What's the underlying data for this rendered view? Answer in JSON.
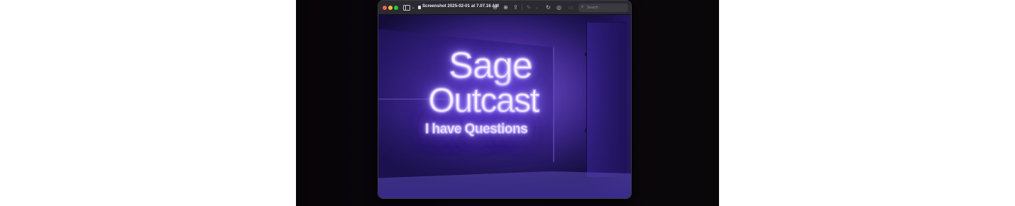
{
  "window": {
    "title": "Screenshot 2025-02-01 at 7.07.16 AM",
    "search_placeholder": "Search"
  },
  "icons": {
    "close": "close-button",
    "minimize": "minimize-button",
    "zoom": "zoom-button",
    "sidebar": "sidebar-icon",
    "document": "document-icon",
    "zoom_out": "zoom-out-icon",
    "zoom_in": "zoom-in-icon",
    "share": "share-icon",
    "markup": "markup-icon",
    "rotate": "rotate-icon",
    "annotate": "annotate-icon",
    "form": "form-fill-icon",
    "search": "search-icon"
  },
  "image": {
    "line1": "Sage",
    "line2": "Outcast",
    "line3": "I have Questions"
  },
  "colors": {
    "close": "#ff5f57",
    "minimize": "#febc2e",
    "zoom": "#28c840",
    "titlebar": "#2b2a30",
    "neon_glow": "#9f80ff"
  }
}
